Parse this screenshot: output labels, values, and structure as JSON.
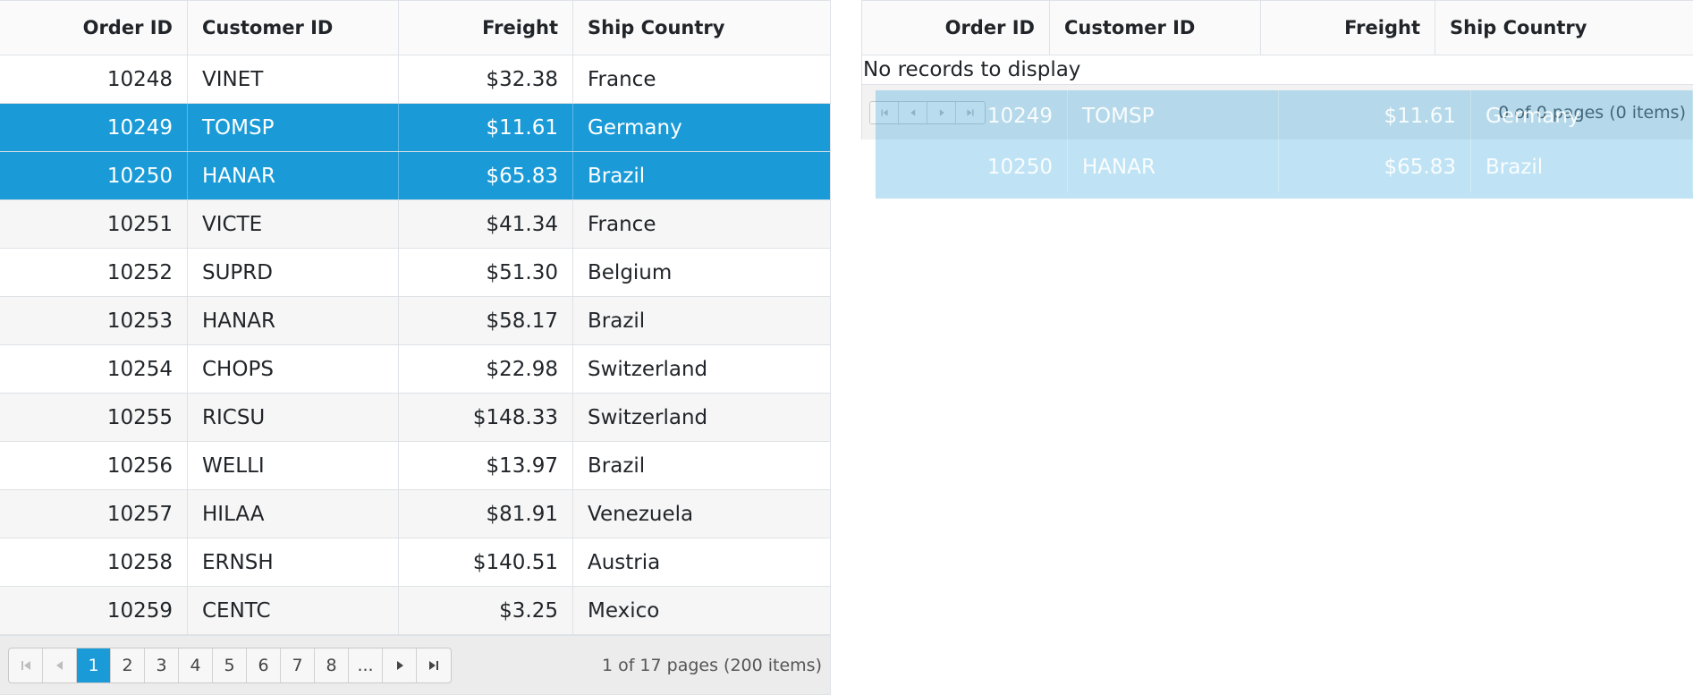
{
  "columns": [
    "Order ID",
    "Customer ID",
    "Freight",
    "Ship Country"
  ],
  "left_rows": [
    {
      "order_id": "10248",
      "customer_id": "VINET",
      "freight": "$32.38",
      "country": "France"
    },
    {
      "order_id": "10249",
      "customer_id": "TOMSP",
      "freight": "$11.61",
      "country": "Germany"
    },
    {
      "order_id": "10250",
      "customer_id": "HANAR",
      "freight": "$65.83",
      "country": "Brazil"
    },
    {
      "order_id": "10251",
      "customer_id": "VICTE",
      "freight": "$41.34",
      "country": "France"
    },
    {
      "order_id": "10252",
      "customer_id": "SUPRD",
      "freight": "$51.30",
      "country": "Belgium"
    },
    {
      "order_id": "10253",
      "customer_id": "HANAR",
      "freight": "$58.17",
      "country": "Brazil"
    },
    {
      "order_id": "10254",
      "customer_id": "CHOPS",
      "freight": "$22.98",
      "country": "Switzerland"
    },
    {
      "order_id": "10255",
      "customer_id": "RICSU",
      "freight": "$148.33",
      "country": "Switzerland"
    },
    {
      "order_id": "10256",
      "customer_id": "WELLI",
      "freight": "$13.97",
      "country": "Brazil"
    },
    {
      "order_id": "10257",
      "customer_id": "HILAA",
      "freight": "$81.91",
      "country": "Venezuela"
    },
    {
      "order_id": "10258",
      "customer_id": "ERNSH",
      "freight": "$140.51",
      "country": "Austria"
    },
    {
      "order_id": "10259",
      "customer_id": "CENTC",
      "freight": "$3.25",
      "country": "Mexico"
    }
  ],
  "selected_order_ids": [
    "10249",
    "10250"
  ],
  "left_pager": {
    "pages": [
      "1",
      "2",
      "3",
      "4",
      "5",
      "6",
      "7",
      "8",
      "..."
    ],
    "current": "1",
    "info": "1 of 17 pages (200 items)"
  },
  "right_grid": {
    "empty_message": "No records to display",
    "pager_info": "0 of 0 pages (0 items)"
  },
  "drag_rows": [
    {
      "order_id": "10249",
      "customer_id": "TOMSP",
      "freight": "$11.61",
      "country": "Germany"
    },
    {
      "order_id": "10250",
      "customer_id": "HANAR",
      "freight": "$65.83",
      "country": "Brazil"
    }
  ],
  "icons": {
    "first": "first-page-icon",
    "prev": "previous-page-icon",
    "next": "next-page-icon",
    "last": "last-page-icon"
  },
  "colors": {
    "selection": "#1a9bd8",
    "alt_row": "#f6f6f6",
    "pager_bg": "#ececec"
  }
}
